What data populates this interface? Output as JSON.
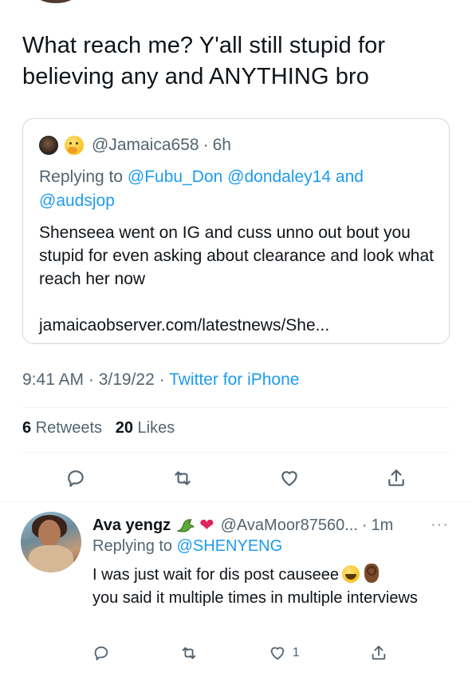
{
  "tweet": {
    "text": "What reach me? Y'all still stupid for believing any and ANYTHING bro",
    "timestamp": "9:41 AM · 3/19/22 · ",
    "source": "Twitter for iPhone",
    "retweets_count": "6",
    "retweets_label": " Retweets",
    "likes_count": "20",
    "likes_label": " Likes"
  },
  "quoted": {
    "handle": "@Jamaica658",
    "time": "6h",
    "dot": "·",
    "replying_prefix": "Replying to ",
    "mention_1": "@Fubu_Don",
    "mention_2": "@dondaley14",
    "and": " and",
    "mention_3": "@audsjop",
    "body": "Shenseea went on IG and cuss unno out bout you stupid for even asking about clearance and look what reach her now",
    "url": "jamaicaobserver.com/latestnews/She..."
  },
  "reply": {
    "name": "Ava yengz",
    "handle": "@AvaMoor87560...",
    "dot": "·",
    "time": "1m",
    "more": "···",
    "replying_prefix": "Replying to ",
    "replying_mention": "@SHENYENG",
    "body_line1": "I was just wait for dis post causeee",
    "body_rest": "you said it multiple times in multiple interviews",
    "like_count": "1"
  },
  "icons": {
    "reply": "reply-icon",
    "retweet": "retweet-icon",
    "like": "heart-icon",
    "share": "share-icon"
  },
  "colors": {
    "link": "#1d9bf0",
    "secondary": "#536471",
    "text": "#0f1419",
    "border": "#cfd9de"
  }
}
